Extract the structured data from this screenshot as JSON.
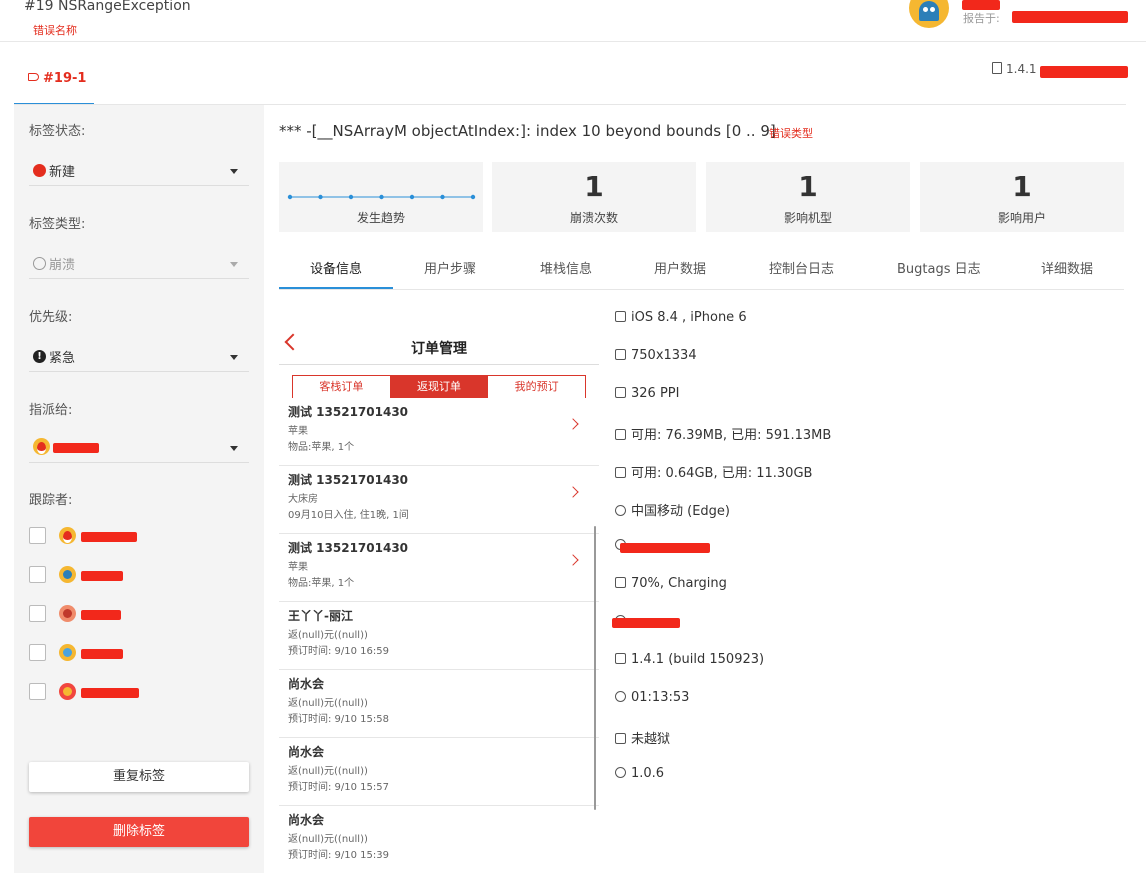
{
  "header": {
    "bug_title": "#19 NSRangeException",
    "bug_title_annotation": "错误名称",
    "reported_at_label": "报告于:"
  },
  "tag_tab": {
    "label": "#19-1"
  },
  "app_version_prefix": "1.4.1",
  "sidebar": {
    "status_label": "标签状态:",
    "status_value": "新建",
    "type_label": "标签类型:",
    "type_value": "崩溃",
    "priority_label": "优先级:",
    "priority_value": "紧急",
    "assignee_label": "指派给:",
    "followers_label": "跟踪者:",
    "duplicate_button": "重复标签",
    "delete_button": "删除标签"
  },
  "exception": {
    "message": "*** -[__NSArrayM objectAtIndex:]: index 10 beyond bounds [0 .. 9]",
    "annotation": "错误类型"
  },
  "stats": [
    {
      "value": "",
      "label": "发生趋势"
    },
    {
      "value": "1",
      "label": "崩溃次数"
    },
    {
      "value": "1",
      "label": "影响机型"
    },
    {
      "value": "1",
      "label": "影响用户"
    }
  ],
  "tabs": [
    "设备信息",
    "用户步骤",
    "堆栈信息",
    "用户数据",
    "控制台日志",
    "Bugtags 日志",
    "详细数据"
  ],
  "phone": {
    "title": "订单管理",
    "segments": [
      "客栈订单",
      "返现订单",
      "我的预订"
    ],
    "orders": [
      {
        "title": "测试  13521701430",
        "line2": "苹果",
        "line3": "物品:苹果, 1个",
        "has_arrow": true
      },
      {
        "title": "测试  13521701430",
        "line2": "大床房",
        "line3": "09月10日入住, 住1晚, 1间",
        "has_arrow": true
      },
      {
        "title": "测试  13521701430",
        "line2": "苹果",
        "line3": "物品:苹果, 1个",
        "has_arrow": true
      },
      {
        "title": "王丫丫-丽江",
        "line2": "返(null)元((null))",
        "line3": "预订时间: 9/10 16:59",
        "has_arrow": false
      },
      {
        "title": "尚水会",
        "line2": "返(null)元((null))",
        "line3": "预订时间: 9/10 15:58",
        "has_arrow": false
      },
      {
        "title": "尚水会",
        "line2": "返(null)元((null))",
        "line3": "预订时间: 9/10 15:57",
        "has_arrow": false
      },
      {
        "title": "尚水会",
        "line2": "返(null)元((null))",
        "line3": "预订时间: 9/10 15:39",
        "has_arrow": false
      }
    ]
  },
  "device_info": [
    {
      "icon": "phone-icon",
      "text": "iOS 8.4 ,  iPhone 6"
    },
    {
      "icon": "resolution-icon",
      "text": "750x1334"
    },
    {
      "icon": "ppi-icon",
      "text": "326 PPI"
    },
    {
      "icon": "memory-icon",
      "text": "可用: 76.39MB,  已用: 591.13MB"
    },
    {
      "icon": "disk-icon",
      "text": "可用: 0.64GB,  已用: 11.30GB"
    },
    {
      "icon": "carrier-icon",
      "text": "中国移动 (Edge)"
    },
    {
      "icon": "wifi-icon",
      "text": ""
    },
    {
      "icon": "battery-icon",
      "text": "70%,  Charging"
    },
    {
      "icon": "location-icon",
      "text": ""
    },
    {
      "icon": "version-icon",
      "text": "1.4.1 (build 150923)"
    },
    {
      "icon": "clock-icon",
      "text": "01:13:53"
    },
    {
      "icon": "jailbreak-icon",
      "text": "未越狱"
    },
    {
      "icon": "sdk-icon",
      "text": "1.0.6"
    }
  ],
  "colors": {
    "accent": "#2a8fd8",
    "danger": "#f1453b",
    "annotation": "#e42d1e"
  }
}
